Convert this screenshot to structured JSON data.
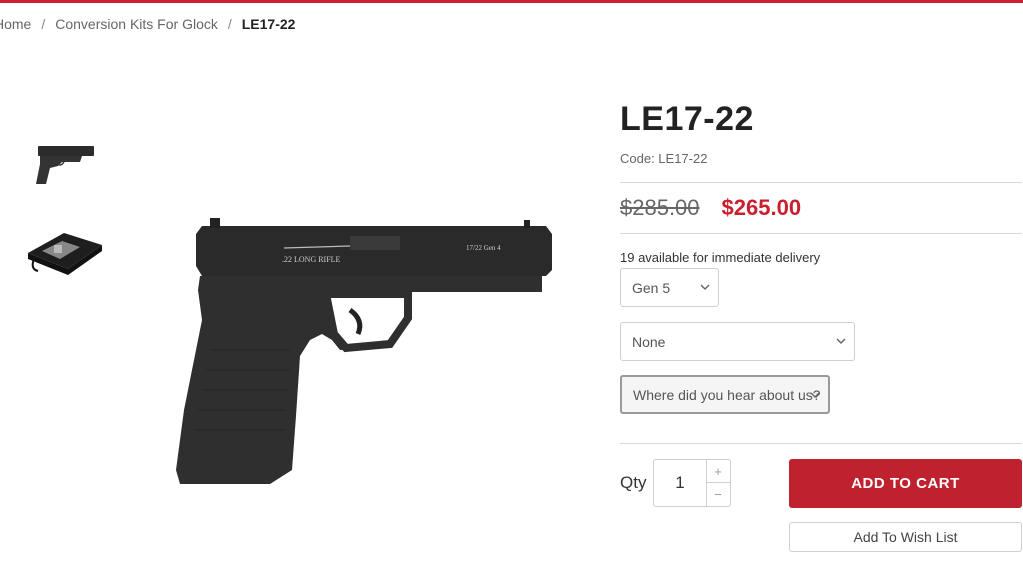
{
  "breadcrumb": {
    "home": "Home",
    "category": "Conversion Kits For Glock",
    "current": "LE17-22",
    "separator": "/"
  },
  "product": {
    "title": "LE17-22",
    "code": "Code: LE17-22",
    "old_price": "$285.00",
    "price": "$265.00",
    "availability": "19 available for immediate delivery",
    "main_image_engraving_1": ".22 LONG RIFLE",
    "main_image_engraving_2": "17/22 Gen 4"
  },
  "options": {
    "generation": "Gen 5",
    "addon": "None",
    "referral_placeholder": "Where did you hear about us?"
  },
  "purchase": {
    "qty_label": "Qty",
    "qty_value": "1",
    "plus": "+",
    "minus": "−",
    "add_to_cart": "ADD TO CART",
    "add_to_wishlist": "Add To Wish List"
  },
  "colors": {
    "accent": "#c8202f",
    "button": "#c0212e"
  }
}
